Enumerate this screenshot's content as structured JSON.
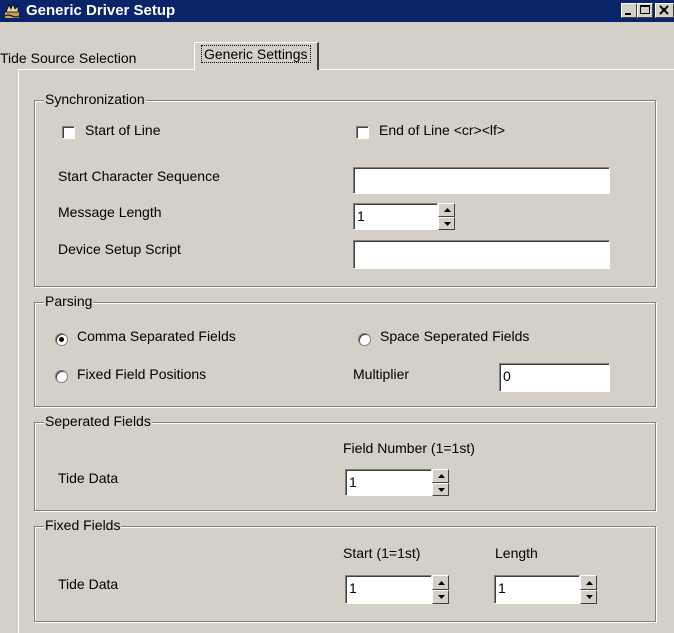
{
  "window": {
    "title": "Generic Driver Setup",
    "controls": [
      "minimize",
      "maximize",
      "close"
    ]
  },
  "tabs": [
    {
      "label": "Tide Source Selection",
      "active": false
    },
    {
      "label": "Generic Settings",
      "active": true
    }
  ],
  "synchronization": {
    "legend": "Synchronization",
    "start_of_line": {
      "label": "Start of Line",
      "checked": false
    },
    "end_of_line": {
      "label": "End of Line <cr><lf>",
      "checked": false
    },
    "start_char_seq": {
      "label": "Start Character Sequence",
      "value": ""
    },
    "message_length": {
      "label": "Message Length",
      "value": "1"
    },
    "device_setup_script": {
      "label": "Device Setup Script",
      "value": ""
    }
  },
  "parsing": {
    "legend": "Parsing",
    "comma_separated": {
      "label": "Comma Separated Fields",
      "selected": true
    },
    "space_separated": {
      "label": "Space Seperated Fields",
      "selected": false
    },
    "fixed_positions": {
      "label": "Fixed Field Positions",
      "selected": false
    },
    "multiplier": {
      "label": "Multiplier",
      "value": "0"
    }
  },
  "separated_fields": {
    "legend": "Seperated Fields",
    "col_header": "Field Number (1=1st)",
    "row_label": "Tide Data",
    "field_number": "1"
  },
  "fixed_fields": {
    "legend": "Fixed Fields",
    "start_header": "Start (1=1st)",
    "length_header": "Length",
    "row_label": "Tide Data",
    "start": "1",
    "length": "1"
  },
  "colors": {
    "titlebar": "#0a246a",
    "face": "#d4d0c8"
  }
}
